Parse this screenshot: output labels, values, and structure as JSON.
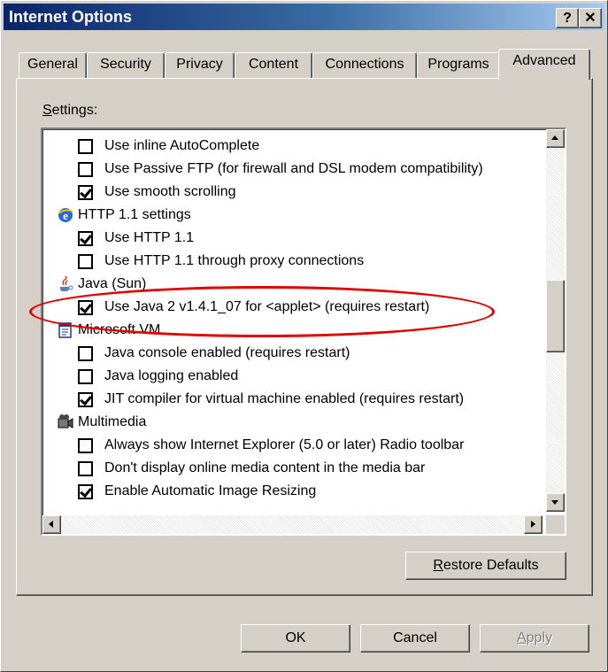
{
  "window": {
    "title": "Internet Options",
    "help_btn": "?",
    "close_btn": "✕"
  },
  "tabs": [
    "General",
    "Security",
    "Privacy",
    "Content",
    "Connections",
    "Programs",
    "Advanced"
  ],
  "active_tab": "Advanced",
  "settings": {
    "label_prefix": "S",
    "label_rest": "ettings:",
    "rows": [
      {
        "type": "check",
        "checked": false,
        "label": "Use inline AutoComplete"
      },
      {
        "type": "check",
        "checked": false,
        "label": "Use Passive FTP (for firewall and DSL modem compatibility)"
      },
      {
        "type": "check",
        "checked": true,
        "label": "Use smooth scrolling"
      },
      {
        "type": "category",
        "icon": "ie-icon",
        "label": "HTTP 1.1 settings"
      },
      {
        "type": "check",
        "checked": true,
        "label": "Use HTTP 1.1"
      },
      {
        "type": "check",
        "checked": false,
        "label": "Use HTTP 1.1 through proxy connections"
      },
      {
        "type": "category",
        "icon": "java-icon",
        "label": "Java (Sun)"
      },
      {
        "type": "check",
        "checked": true,
        "label": "Use Java 2 v1.4.1_07 for <applet> (requires restart)"
      },
      {
        "type": "category",
        "icon": "vm-icon",
        "label": "Microsoft VM"
      },
      {
        "type": "check",
        "checked": false,
        "label": "Java console enabled (requires restart)"
      },
      {
        "type": "check",
        "checked": false,
        "label": "Java logging enabled"
      },
      {
        "type": "check",
        "checked": true,
        "label": "JIT compiler for virtual machine enabled (requires restart)"
      },
      {
        "type": "category",
        "icon": "multimedia-icon",
        "label": "Multimedia"
      },
      {
        "type": "check",
        "checked": false,
        "label": "Always show Internet Explorer (5.0 or later) Radio toolbar"
      },
      {
        "type": "check",
        "checked": false,
        "label": "Don't display online media content in the media bar"
      },
      {
        "type": "check",
        "checked": true,
        "label": "Enable Automatic Image Resizing"
      }
    ]
  },
  "buttons": {
    "restore_prefix": "R",
    "restore_rest": "estore Defaults",
    "ok": "OK",
    "cancel": "Cancel",
    "apply_prefix": "A",
    "apply_rest": "pply"
  },
  "colors": {
    "highlight": "#e00000",
    "title_start": "#0a246a",
    "title_end": "#a6caf0"
  }
}
